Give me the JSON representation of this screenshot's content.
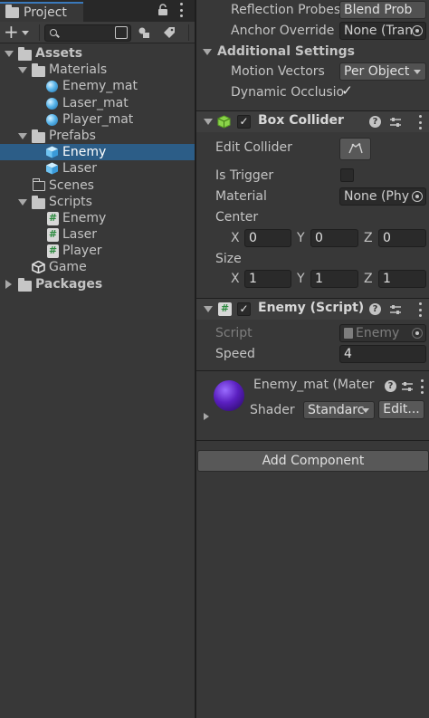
{
  "project": {
    "tab_label": "Project",
    "search_value": "",
    "tree": [
      {
        "label": "Assets",
        "bold": true,
        "icon": "folder-open-icon",
        "expanded": true
      },
      {
        "label": "Materials",
        "icon": "folder-open-icon",
        "expanded": true
      },
      {
        "label": "Enemy_mat",
        "icon": "material-icon"
      },
      {
        "label": "Laser_mat",
        "icon": "material-icon"
      },
      {
        "label": "Player_mat",
        "icon": "material-icon"
      },
      {
        "label": "Prefabs",
        "icon": "folder-open-icon",
        "expanded": true
      },
      {
        "label": "Enemy",
        "icon": "prefab-icon",
        "selected": true
      },
      {
        "label": "Laser",
        "icon": "prefab-icon"
      },
      {
        "label": "Scenes",
        "icon": "folder-icon"
      },
      {
        "label": "Scripts",
        "icon": "folder-open-icon",
        "expanded": true
      },
      {
        "label": "Enemy",
        "icon": "script-icon"
      },
      {
        "label": "Laser",
        "icon": "script-icon"
      },
      {
        "label": "Player",
        "icon": "script-icon"
      },
      {
        "label": "Game",
        "icon": "unity-scene-icon"
      },
      {
        "label": "Packages",
        "bold": true,
        "icon": "folder-icon",
        "expanded": false
      }
    ]
  },
  "inspector": {
    "reflection_probes": {
      "label": "Reflection Probes",
      "value": "Blend Prob"
    },
    "anchor_override": {
      "label": "Anchor Override",
      "value": "None (Tran"
    },
    "additional_settings": {
      "label": "Additional Settings"
    },
    "motion_vectors": {
      "label": "Motion Vectors",
      "value": "Per Object"
    },
    "dynamic_occlusion": {
      "label": "Dynamic Occlusio",
      "checked": "✓"
    },
    "box_collider": {
      "title": "Box Collider",
      "enabled": "✓",
      "edit_collider": {
        "label": "Edit Collider"
      },
      "is_trigger": {
        "label": "Is Trigger",
        "checked": ""
      },
      "material": {
        "label": "Material",
        "value": "None (Phy"
      },
      "center": {
        "label": "Center",
        "x_label": "X",
        "x": "0",
        "y_label": "Y",
        "y": "0",
        "z_label": "Z",
        "z": "0"
      },
      "size": {
        "label": "Size",
        "x_label": "X",
        "x": "1",
        "y_label": "Y",
        "y": "1",
        "z_label": "Z",
        "z": "1"
      }
    },
    "enemy_script": {
      "title": "Enemy (Script)",
      "enabled": "✓",
      "script": {
        "label": "Script",
        "value": "Enemy"
      },
      "speed": {
        "label": "Speed",
        "value": "4"
      }
    },
    "material": {
      "title": "Enemy_mat (Mater",
      "shader_label": "Shader",
      "shader_value": "Standarc",
      "edit_label": "Edit..."
    },
    "add_component_label": "Add Component"
  },
  "colors": {
    "selection": "#2c5d87",
    "tab_accent": "#3a79bb",
    "material_sphere": "#5a1fc0"
  }
}
